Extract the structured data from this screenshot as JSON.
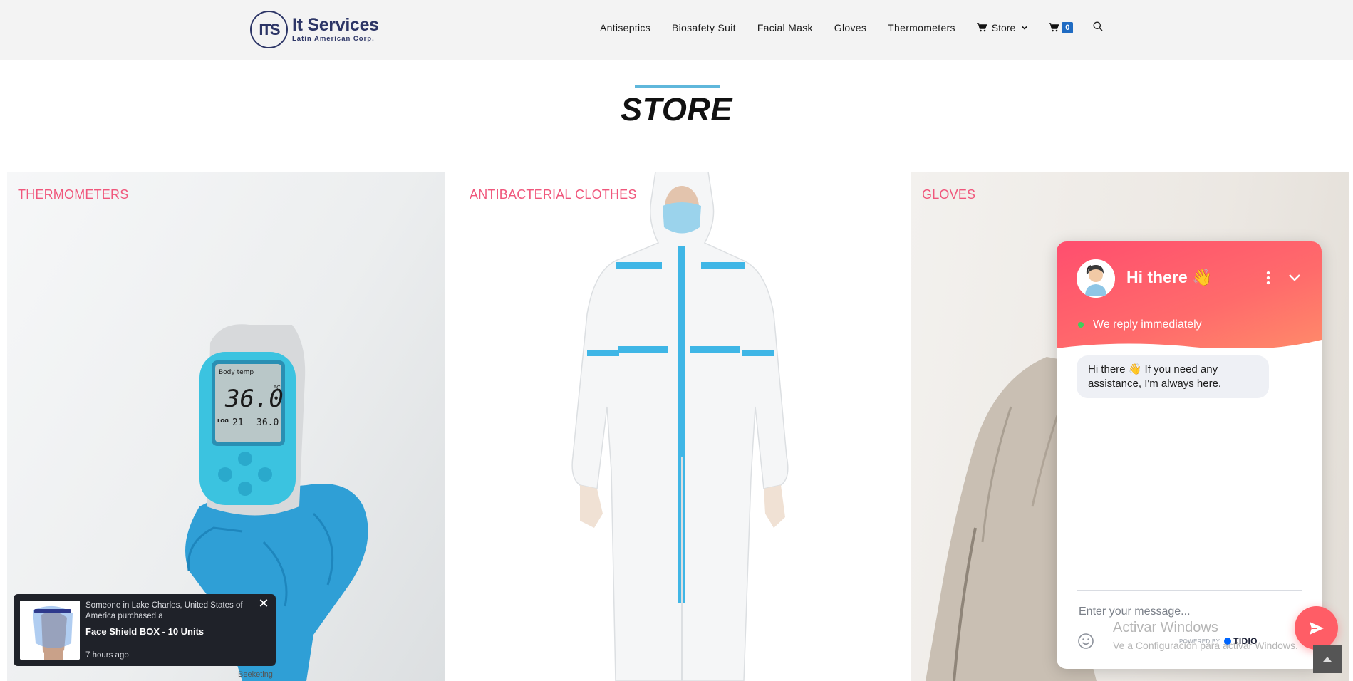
{
  "header": {
    "logo_mark": "ITS",
    "logo_title": "It Services",
    "logo_subtitle": "Latin American Corp.",
    "nav": [
      "Antiseptics",
      "Biosafety Suit",
      "Facial Mask",
      "Gloves",
      "Thermometers"
    ],
    "store_label": "Store",
    "cart_count": "0"
  },
  "page": {
    "heading": "STORE"
  },
  "categories": [
    {
      "label": "THERMOMETERS",
      "image": "infrared-thermometer-photo"
    },
    {
      "label": "ANTIBACTERIAL CLOTHES",
      "image": "biosafety-suit-photo"
    },
    {
      "label": "GLOVES",
      "image": "gloves-photo"
    }
  ],
  "thermometer_display": {
    "mode": "Body temp",
    "unit": "°C",
    "reading": "36.0",
    "log_label": "LOG",
    "log_index": "21",
    "log_value": "36.0"
  },
  "notification": {
    "line1": "Someone in Lake Charles, United States of America purchased a",
    "product": "Face Shield BOX - 10 Units",
    "time": "7 hours ago",
    "brand": "Beeketing"
  },
  "chat": {
    "title": "Hi there 👋",
    "status": "We reply immediately",
    "message": "Hi there 👋 If you need any assistance, I'm always here.",
    "placeholder": "Enter your message...",
    "powered_by": "POWERED BY",
    "brand": "TIDIO"
  },
  "watermark": {
    "title": "Activar Windows",
    "subtitle": "Ve a Configuración para activar Windows."
  },
  "colors": {
    "accent_pink": "#f0577c",
    "chat_gradient": "#ff4e6e",
    "heading_bar": "#5fb7db",
    "badge": "#1f6bc2"
  }
}
